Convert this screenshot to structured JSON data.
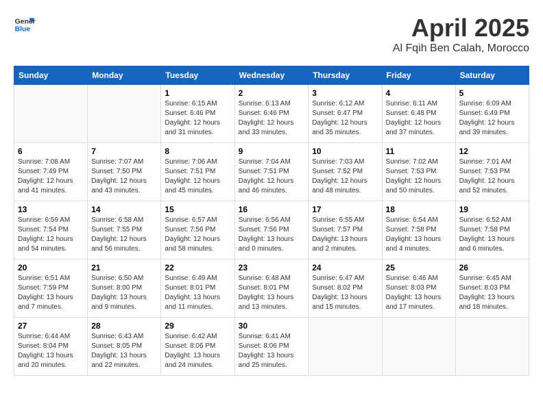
{
  "header": {
    "logo_line1": "General",
    "logo_line2": "Blue",
    "month_title": "April 2025",
    "location": "Al Fqih Ben Calah, Morocco"
  },
  "weekdays": [
    "Sunday",
    "Monday",
    "Tuesday",
    "Wednesday",
    "Thursday",
    "Friday",
    "Saturday"
  ],
  "weeks": [
    [
      {
        "day": "",
        "info": ""
      },
      {
        "day": "",
        "info": ""
      },
      {
        "day": "1",
        "info": "Sunrise: 6:15 AM\nSunset: 6:46 PM\nDaylight: 12 hours and 31 minutes."
      },
      {
        "day": "2",
        "info": "Sunrise: 6:13 AM\nSunset: 6:46 PM\nDaylight: 12 hours and 33 minutes."
      },
      {
        "day": "3",
        "info": "Sunrise: 6:12 AM\nSunset: 6:47 PM\nDaylight: 12 hours and 35 minutes."
      },
      {
        "day": "4",
        "info": "Sunrise: 6:11 AM\nSunset: 6:48 PM\nDaylight: 12 hours and 37 minutes."
      },
      {
        "day": "5",
        "info": "Sunrise: 6:09 AM\nSunset: 6:49 PM\nDaylight: 12 hours and 39 minutes."
      }
    ],
    [
      {
        "day": "6",
        "info": "Sunrise: 7:08 AM\nSunset: 7:49 PM\nDaylight: 12 hours and 41 minutes."
      },
      {
        "day": "7",
        "info": "Sunrise: 7:07 AM\nSunset: 7:50 PM\nDaylight: 12 hours and 43 minutes."
      },
      {
        "day": "8",
        "info": "Sunrise: 7:06 AM\nSunset: 7:51 PM\nDaylight: 12 hours and 45 minutes."
      },
      {
        "day": "9",
        "info": "Sunrise: 7:04 AM\nSunset: 7:51 PM\nDaylight: 12 hours and 46 minutes."
      },
      {
        "day": "10",
        "info": "Sunrise: 7:03 AM\nSunset: 7:52 PM\nDaylight: 12 hours and 48 minutes."
      },
      {
        "day": "11",
        "info": "Sunrise: 7:02 AM\nSunset: 7:53 PM\nDaylight: 12 hours and 50 minutes."
      },
      {
        "day": "12",
        "info": "Sunrise: 7:01 AM\nSunset: 7:53 PM\nDaylight: 12 hours and 52 minutes."
      }
    ],
    [
      {
        "day": "13",
        "info": "Sunrise: 6:59 AM\nSunset: 7:54 PM\nDaylight: 12 hours and 54 minutes."
      },
      {
        "day": "14",
        "info": "Sunrise: 6:58 AM\nSunset: 7:55 PM\nDaylight: 12 hours and 56 minutes."
      },
      {
        "day": "15",
        "info": "Sunrise: 6:57 AM\nSunset: 7:56 PM\nDaylight: 12 hours and 58 minutes."
      },
      {
        "day": "16",
        "info": "Sunrise: 6:56 AM\nSunset: 7:56 PM\nDaylight: 13 hours and 0 minutes."
      },
      {
        "day": "17",
        "info": "Sunrise: 6:55 AM\nSunset: 7:57 PM\nDaylight: 13 hours and 2 minutes."
      },
      {
        "day": "18",
        "info": "Sunrise: 6:54 AM\nSunset: 7:58 PM\nDaylight: 13 hours and 4 minutes."
      },
      {
        "day": "19",
        "info": "Sunrise: 6:52 AM\nSunset: 7:58 PM\nDaylight: 13 hours and 6 minutes."
      }
    ],
    [
      {
        "day": "20",
        "info": "Sunrise: 6:51 AM\nSunset: 7:59 PM\nDaylight: 13 hours and 7 minutes."
      },
      {
        "day": "21",
        "info": "Sunrise: 6:50 AM\nSunset: 8:00 PM\nDaylight: 13 hours and 9 minutes."
      },
      {
        "day": "22",
        "info": "Sunrise: 6:49 AM\nSunset: 8:01 PM\nDaylight: 13 hours and 11 minutes."
      },
      {
        "day": "23",
        "info": "Sunrise: 6:48 AM\nSunset: 8:01 PM\nDaylight: 13 hours and 13 minutes."
      },
      {
        "day": "24",
        "info": "Sunrise: 6:47 AM\nSunset: 8:02 PM\nDaylight: 13 hours and 15 minutes."
      },
      {
        "day": "25",
        "info": "Sunrise: 6:46 AM\nSunset: 8:03 PM\nDaylight: 13 hours and 17 minutes."
      },
      {
        "day": "26",
        "info": "Sunrise: 6:45 AM\nSunset: 8:03 PM\nDaylight: 13 hours and 18 minutes."
      }
    ],
    [
      {
        "day": "27",
        "info": "Sunrise: 6:44 AM\nSunset: 8:04 PM\nDaylight: 13 hours and 20 minutes."
      },
      {
        "day": "28",
        "info": "Sunrise: 6:43 AM\nSunset: 8:05 PM\nDaylight: 13 hours and 22 minutes."
      },
      {
        "day": "29",
        "info": "Sunrise: 6:42 AM\nSunset: 8:06 PM\nDaylight: 13 hours and 24 minutes."
      },
      {
        "day": "30",
        "info": "Sunrise: 6:41 AM\nSunset: 8:06 PM\nDaylight: 13 hours and 25 minutes."
      },
      {
        "day": "",
        "info": ""
      },
      {
        "day": "",
        "info": ""
      },
      {
        "day": "",
        "info": ""
      }
    ]
  ]
}
